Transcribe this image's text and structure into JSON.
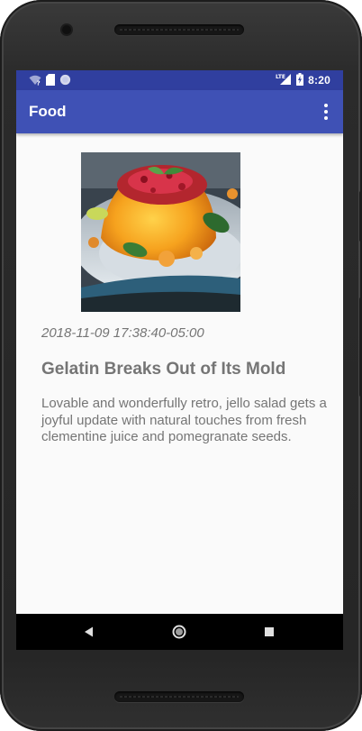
{
  "status_bar": {
    "time": "8:20",
    "network_label": "LTE",
    "icons": [
      "wifi-unknown-icon",
      "sim-card-icon",
      "sync-circle-icon",
      "lte-signal-icon",
      "battery-charging-icon"
    ]
  },
  "app_bar": {
    "title": "Food",
    "overflow_icon": "more-vert-icon"
  },
  "article": {
    "image_icon": "food-photo",
    "timestamp": "2018-11-09 17:38:40-05:00",
    "title": "Gelatin Breaks Out of Its Mold",
    "body": "Lovable and wonderfully retro, jello salad gets a joyful update with natural touches from fresh clementine juice and pomegranate seeds."
  },
  "nav_bar": {
    "icons": [
      "back-icon",
      "home-icon",
      "recents-icon"
    ]
  },
  "colors": {
    "status_bar": "#303f9f",
    "app_bar": "#3f51b5",
    "screen_background": "#fafafa",
    "text": "#757575",
    "nav_bar": "#000000"
  }
}
